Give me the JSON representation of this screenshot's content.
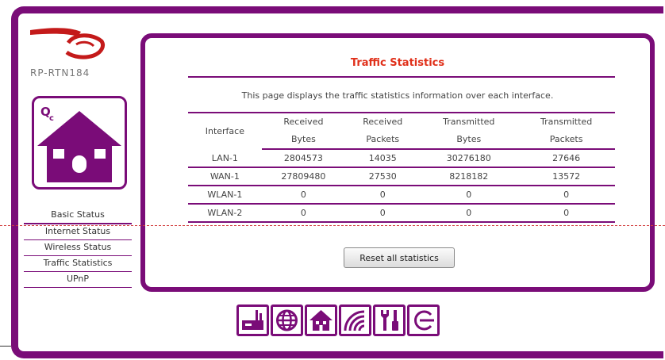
{
  "brand": {
    "model": "RP-RTN184"
  },
  "sidebar": {
    "items": [
      {
        "label": "Basic Status"
      },
      {
        "label": "Internet Status"
      },
      {
        "label": "Wireless Status"
      },
      {
        "label": "Traffic Statistics"
      },
      {
        "label": "UPnP"
      }
    ]
  },
  "main": {
    "title": "Traffic Statistics",
    "description": "This page displays the traffic statistics information over each interface.",
    "table": {
      "headers_line1": [
        "Interface",
        "Received",
        "Received",
        "Transmitted",
        "Transmitted"
      ],
      "headers_line2": [
        "",
        "Bytes",
        "Packets",
        "Bytes",
        "Packets"
      ],
      "rows": [
        [
          "LAN-1",
          "2804573",
          "14035",
          "30276180",
          "27646"
        ],
        [
          "WAN-1",
          "27809480",
          "27530",
          "8218182",
          "13572"
        ],
        [
          "WLAN-1",
          "0",
          "0",
          "0",
          "0"
        ],
        [
          "WLAN-2",
          "0",
          "0",
          "0",
          "0"
        ]
      ]
    },
    "reset_label": "Reset all statistics"
  },
  "toolbar": {
    "icons": [
      "router-icon",
      "globe-icon",
      "home-icon",
      "wireless-icon",
      "tools-icon",
      "logout-icon"
    ]
  },
  "colors": {
    "accent": "#7a0c78",
    "title": "#e0301a"
  }
}
